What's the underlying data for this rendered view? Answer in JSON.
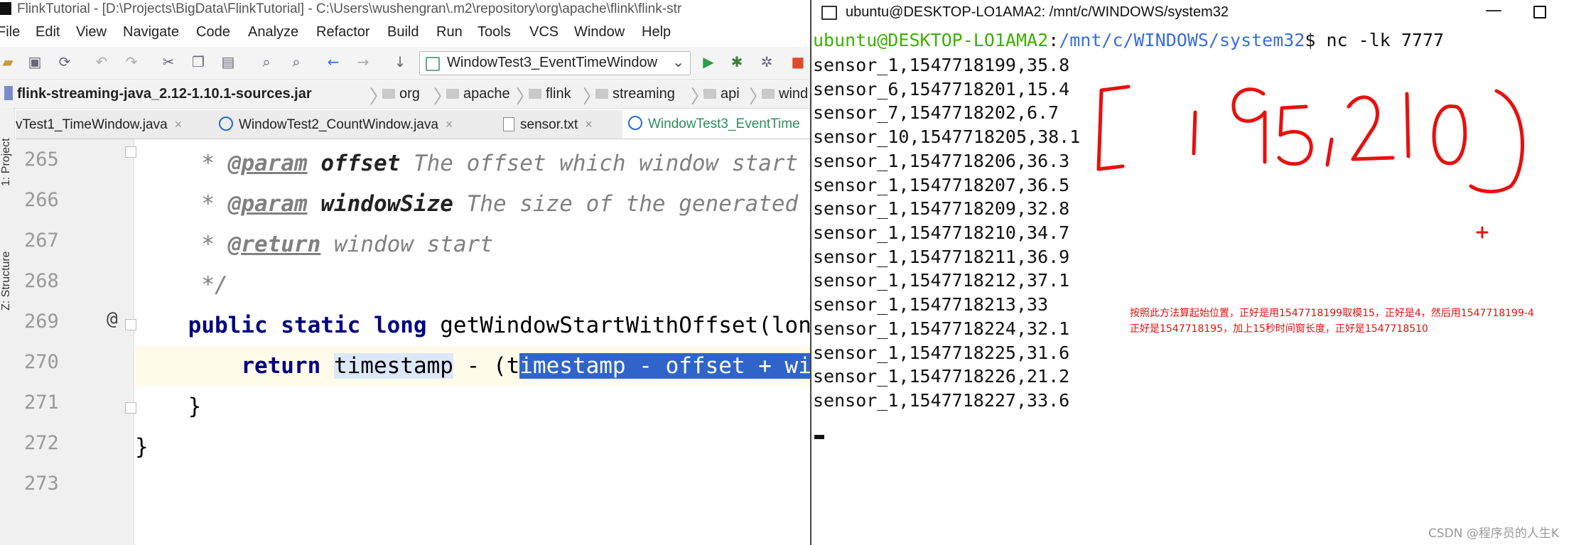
{
  "ide": {
    "window_title": "FlinkTutorial - [D:\\Projects\\BigData\\FlinkTutorial] - C:\\Users\\wushengran\\.m2\\repository\\org\\apache\\flink\\flink-str",
    "menu": [
      "File",
      "Edit",
      "View",
      "Navigate",
      "Code",
      "Analyze",
      "Refactor",
      "Build",
      "Run",
      "Tools",
      "VCS",
      "Window",
      "Help"
    ],
    "run_config": "WindowTest3_EventTimeWindow",
    "breadcrumbs": [
      "flink-streaming-java_2.12-1.10.1-sources.jar",
      "org",
      "apache",
      "flink",
      "streaming",
      "api",
      "wind"
    ],
    "tabs": [
      {
        "label": "vTest1_TimeWindow.java",
        "active": false
      },
      {
        "label": "WindowTest2_CountWindow.java",
        "active": false
      },
      {
        "label": "sensor.txt",
        "active": false
      },
      {
        "label": "WindowTest3_EventTime",
        "active": true
      }
    ],
    "side_labels": [
      "1: Project",
      "Z: Structure"
    ],
    "lines": [
      {
        "num": "265"
      },
      {
        "num": "266"
      },
      {
        "num": "267"
      },
      {
        "num": "268"
      },
      {
        "num": "269"
      },
      {
        "num": "270"
      },
      {
        "num": "271"
      },
      {
        "num": "272"
      },
      {
        "num": "273"
      }
    ],
    "code": {
      "l265": {
        "star": "     * ",
        "tag": "@param",
        "sp": " ",
        "name": "offset",
        "rest": " The offset which window start"
      },
      "l266": {
        "star": "     * ",
        "tag": "@param",
        "sp": " ",
        "name": "windowSize",
        "rest": " The size of the generated"
      },
      "l267": {
        "star": "     * ",
        "tag": "@return",
        "rest": " window start"
      },
      "l268": {
        "text": "     */"
      },
      "l269": {
        "indent": "    ",
        "kw": "public static long",
        "rest": " getWindowStartWithOffset(lon"
      },
      "l270": {
        "indent": "        ",
        "kw": "return",
        "sp": " ",
        "var": "timestamp",
        "mid": " - (t",
        "sel": "imestamp - offset + wi"
      },
      "l271": {
        "text": "    }"
      },
      "l272": {
        "text": "}"
      }
    }
  },
  "terminal": {
    "title": "ubuntu@DESKTOP-LO1AMA2: /mnt/c/WINDOWS/system32",
    "prompt_user": "ubuntu@DESKTOP-LO1AMA2",
    "prompt_sep": ":",
    "prompt_path": "/mnt/c/WINDOWS/system32",
    "prompt_cmd": "$ nc -lk 7777",
    "lines": [
      "sensor_1,1547718199,35.8",
      "sensor_6,1547718201,15.4",
      "sensor_7,1547718202,6.7",
      "sensor_10,1547718205,38.1",
      "sensor_1,1547718206,36.3",
      "sensor_1,1547718207,36.5",
      "sensor_1,1547718209,32.8",
      "sensor_1,1547718210,34.7",
      "sensor_1,1547718211,36.9",
      "sensor_1,1547718212,37.1",
      "sensor_1,1547718213,33",
      "sensor_1,1547718224,32.1",
      "sensor_1,1547718225,31.6",
      "sensor_1,1547718226,21.2",
      "sensor_1,1547718227,33.6"
    ],
    "annotation": {
      "handwritten": "[195,210)",
      "note_line1": "按照此方法算起始位置，正好是用1547718199取模15，正好是4，然后用1547718199-4",
      "note_line2": "正好是1547718195，加上15秒时间窗长度，正好是1547718510",
      "color": "#e01010"
    },
    "watermark": "CSDN @程序员的人生K"
  }
}
